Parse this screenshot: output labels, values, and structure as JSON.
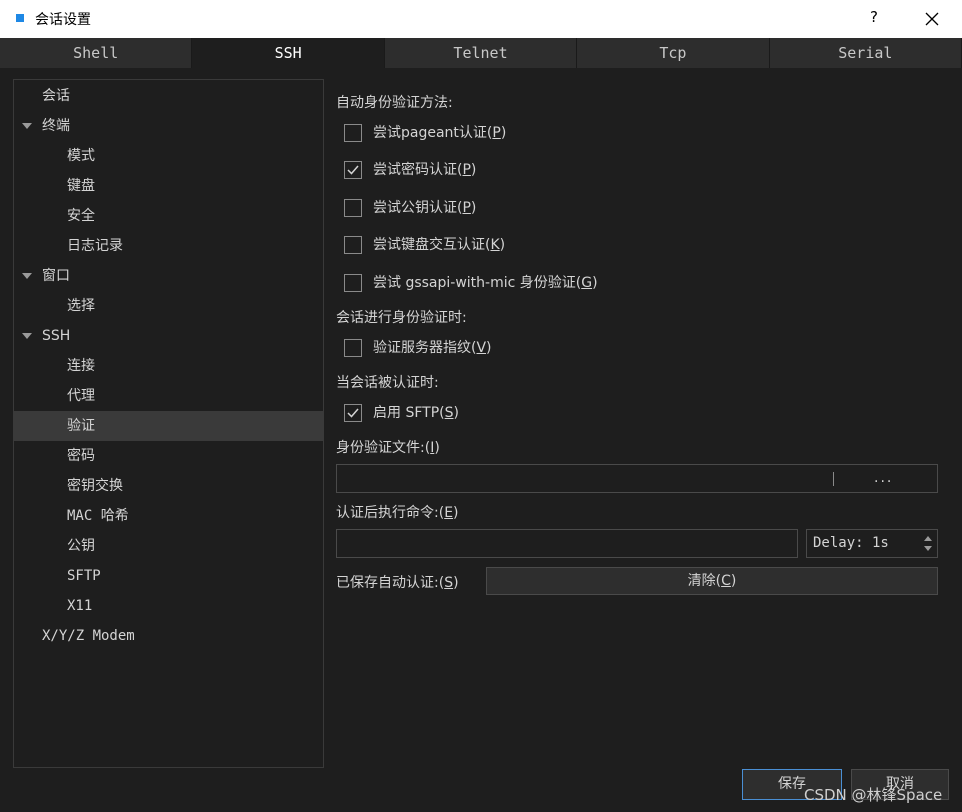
{
  "window": {
    "title": "会话设置",
    "help": "?"
  },
  "tabs": [
    "Shell",
    "SSH",
    "Telnet",
    "Tcp",
    "Serial"
  ],
  "tree": {
    "session": "会话",
    "terminal": "终端",
    "mode": "模式",
    "keyboard": "键盘",
    "security": "安全",
    "logging": "日志记录",
    "window": "窗口",
    "selection": "选择",
    "ssh": "SSH",
    "connection": "连接",
    "proxy": "代理",
    "auth": "验证",
    "password": "密码",
    "kex": "密钥交换",
    "mac": "MAC 哈希",
    "pubkey": "公钥",
    "sftp": "SFTP",
    "x11": "X11",
    "xyz": "X/Y/Z Modem"
  },
  "auth": {
    "auto_methods_label": "自动身份验证方法:",
    "pageant": {
      "pre": "尝试pageant认证(",
      "key": "P",
      "post": ")",
      "checked": false
    },
    "password": {
      "pre": "尝试密码认证(",
      "key": "P",
      "post": ")",
      "checked": true
    },
    "publickey": {
      "pre": "尝试公钥认证(",
      "key": "P",
      "post": ")",
      "checked": false
    },
    "keyboard": {
      "pre": "尝试键盘交互认证(",
      "key": "K",
      "post": ")",
      "checked": false
    },
    "gssapi": {
      "pre": "尝试 gssapi-with-mic 身份验证(",
      "key": "G",
      "post": ")",
      "checked": false
    },
    "during_label": "会话进行身份验证时:",
    "verify_fp": {
      "pre": "验证服务器指纹(",
      "key": "V",
      "post": ")",
      "checked": false
    },
    "after_label": "当会话被认证时:",
    "enable_sftp": {
      "pre": "启用 SFTP(",
      "key": "S",
      "post": ")",
      "checked": true
    },
    "id_file_label": {
      "pre": "身份验证文件:(",
      "key": "I",
      "post": ")"
    },
    "id_file_value": "",
    "browse": "...",
    "post_cmd_label": {
      "pre": "认证后执行命令:(",
      "key": "E",
      "post": ")"
    },
    "post_cmd_value": "",
    "delay": "Delay: 1s",
    "saved_label": {
      "pre": "已保存自动认证:(",
      "key": "S",
      "post": ")"
    },
    "clear": {
      "pre": "清除(",
      "key": "C",
      "post": ")"
    }
  },
  "buttons": {
    "save": "保存",
    "cancel": "取消"
  },
  "watermark": "CSDN @林锋Space",
  "colors": {
    "accent": "#4a8fd4",
    "selected": "#3a3a3a",
    "background": "#1e1e1e"
  }
}
